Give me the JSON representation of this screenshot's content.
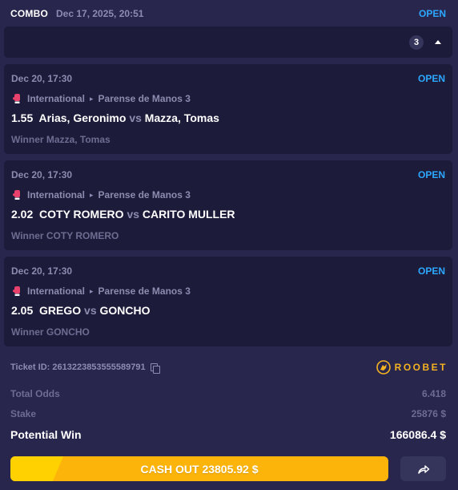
{
  "header": {
    "title": "COMBO",
    "date": "Dec 17, 2025, 20:51",
    "status": "OPEN"
  },
  "collapse": {
    "count": "3"
  },
  "bets": [
    {
      "date": "Dec 20, 17:30",
      "status": "OPEN",
      "category": "International",
      "league": "Parense de Manos 3",
      "odds": "1.55",
      "home": "Arias, Geronimo",
      "vs": "vs",
      "away": "Mazza, Tomas",
      "selection": "Winner Mazza, Tomas"
    },
    {
      "date": "Dec 20, 17:30",
      "status": "OPEN",
      "category": "International",
      "league": "Parense de Manos 3",
      "odds": "2.02",
      "home": "COTY ROMERO",
      "vs": "vs",
      "away": "CARITO MULLER",
      "selection": "Winner COTY ROMERO"
    },
    {
      "date": "Dec 20, 17:30",
      "status": "OPEN",
      "category": "International",
      "league": "Parense de Manos 3",
      "odds": "2.05",
      "home": "GREGO",
      "vs": "vs",
      "away": "GONCHO",
      "selection": "Winner GONCHO"
    }
  ],
  "ticket": {
    "id_text": "Ticket ID: 2613223853555589791",
    "brand": "ROOBET"
  },
  "summary": {
    "total_odds_label": "Total Odds",
    "total_odds_value": "6.418",
    "stake_label": "Stake",
    "stake_value": "25876 $",
    "potential_win_label": "Potential Win",
    "potential_win_value": "166086.4 $"
  },
  "actions": {
    "cashout_label": "CASH OUT 23805.92 $",
    "cashout_progress_pct": 14
  },
  "colors": {
    "background": "#28264d",
    "card": "#1d1b3a",
    "accent_blue": "#2da8ff",
    "muted": "#8e8bb0",
    "cashout": "#fdb40a",
    "brand": "#f5b321"
  },
  "icons": {
    "sport": "boxing-glove-icon",
    "copy": "copy-icon",
    "share": "share-arrow-icon",
    "collapse": "chevron-up-icon"
  }
}
